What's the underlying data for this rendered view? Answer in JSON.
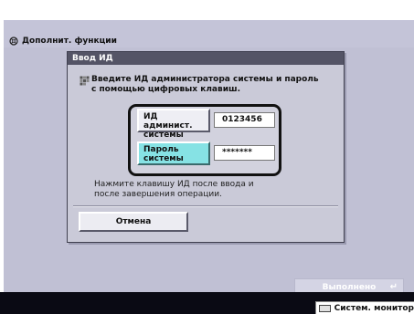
{
  "background": {
    "title": "Дополнит. функции",
    "done_label": "Выполнено",
    "status_monitor_label": "Систем. монитор"
  },
  "dialog": {
    "title": "Ввод ИД",
    "message_line1": "Введите ИД администратора системы и пароль",
    "message_line2": "с помощью цифровых клавиш.",
    "admin_id_label_line1": "ИД админист.",
    "admin_id_label_line2": "системы",
    "admin_id_value": "0123456",
    "password_label_line1": "Пароль",
    "password_label_line2": "системы",
    "password_value": "*******",
    "hint_line1": "Нажмите клавишу ИД после ввода и",
    "hint_line2": "после завершения операции.",
    "cancel_label": "Отмена"
  },
  "icons": [
    "gear-icon",
    "keypad-icon",
    "return-icon",
    "monitor-icon"
  ],
  "colors": {
    "screen_bg": "#c0c0d4",
    "dialog_bg": "#cacad8",
    "dialog_title_bg": "#545466",
    "selected_button": "#86e2e4",
    "bottom_bar": "#0a0a14"
  }
}
